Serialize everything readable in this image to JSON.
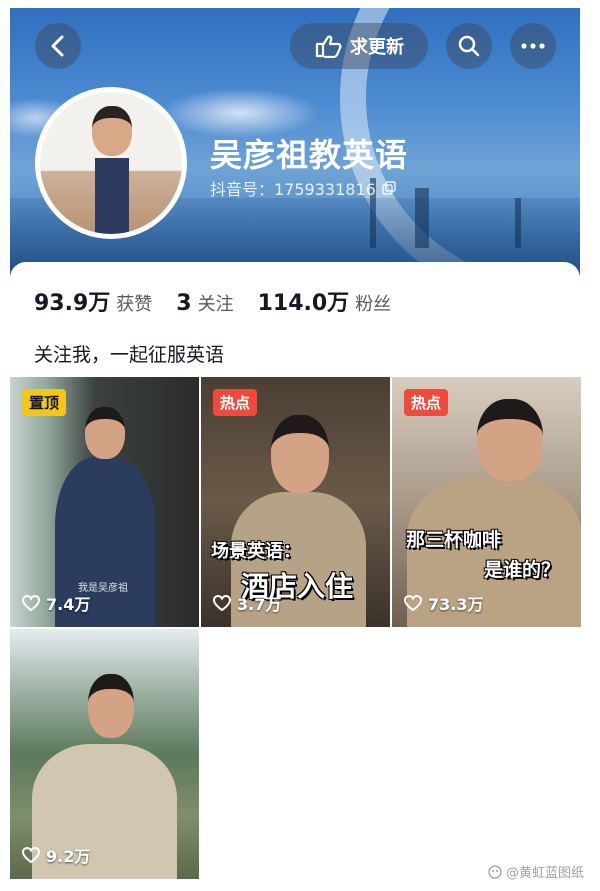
{
  "header": {
    "update_label": "求更新",
    "name": "吴彦祖教英语",
    "douyin_id": "抖音号：1759331816"
  },
  "stats": [
    {
      "value": "93.9万",
      "label": "获赞"
    },
    {
      "value": "3",
      "label": "关注"
    },
    {
      "value": "114.0万",
      "label": "粉丝"
    }
  ],
  "bio": "关注我，一起征服英语",
  "videos": [
    {
      "badge": "置顶",
      "likes": "7.4万",
      "caption": "我是吴彦祖"
    },
    {
      "badge": "热点",
      "likes": "3.7万",
      "overlay_top": "场景英语：",
      "overlay_bottom": "酒店入住"
    },
    {
      "badge": "热点",
      "likes": "73.3万",
      "overlay_top": "那三杯咖啡",
      "overlay_bottom": "是谁的？"
    },
    {
      "badge": "",
      "likes": "9.2万"
    }
  ],
  "watermark": "@黄虹蓝图纸",
  "colors": {
    "pin_badge": "#f5c518",
    "hot_badge": "#f04a3e",
    "header_blue": "#4d8bd1"
  }
}
